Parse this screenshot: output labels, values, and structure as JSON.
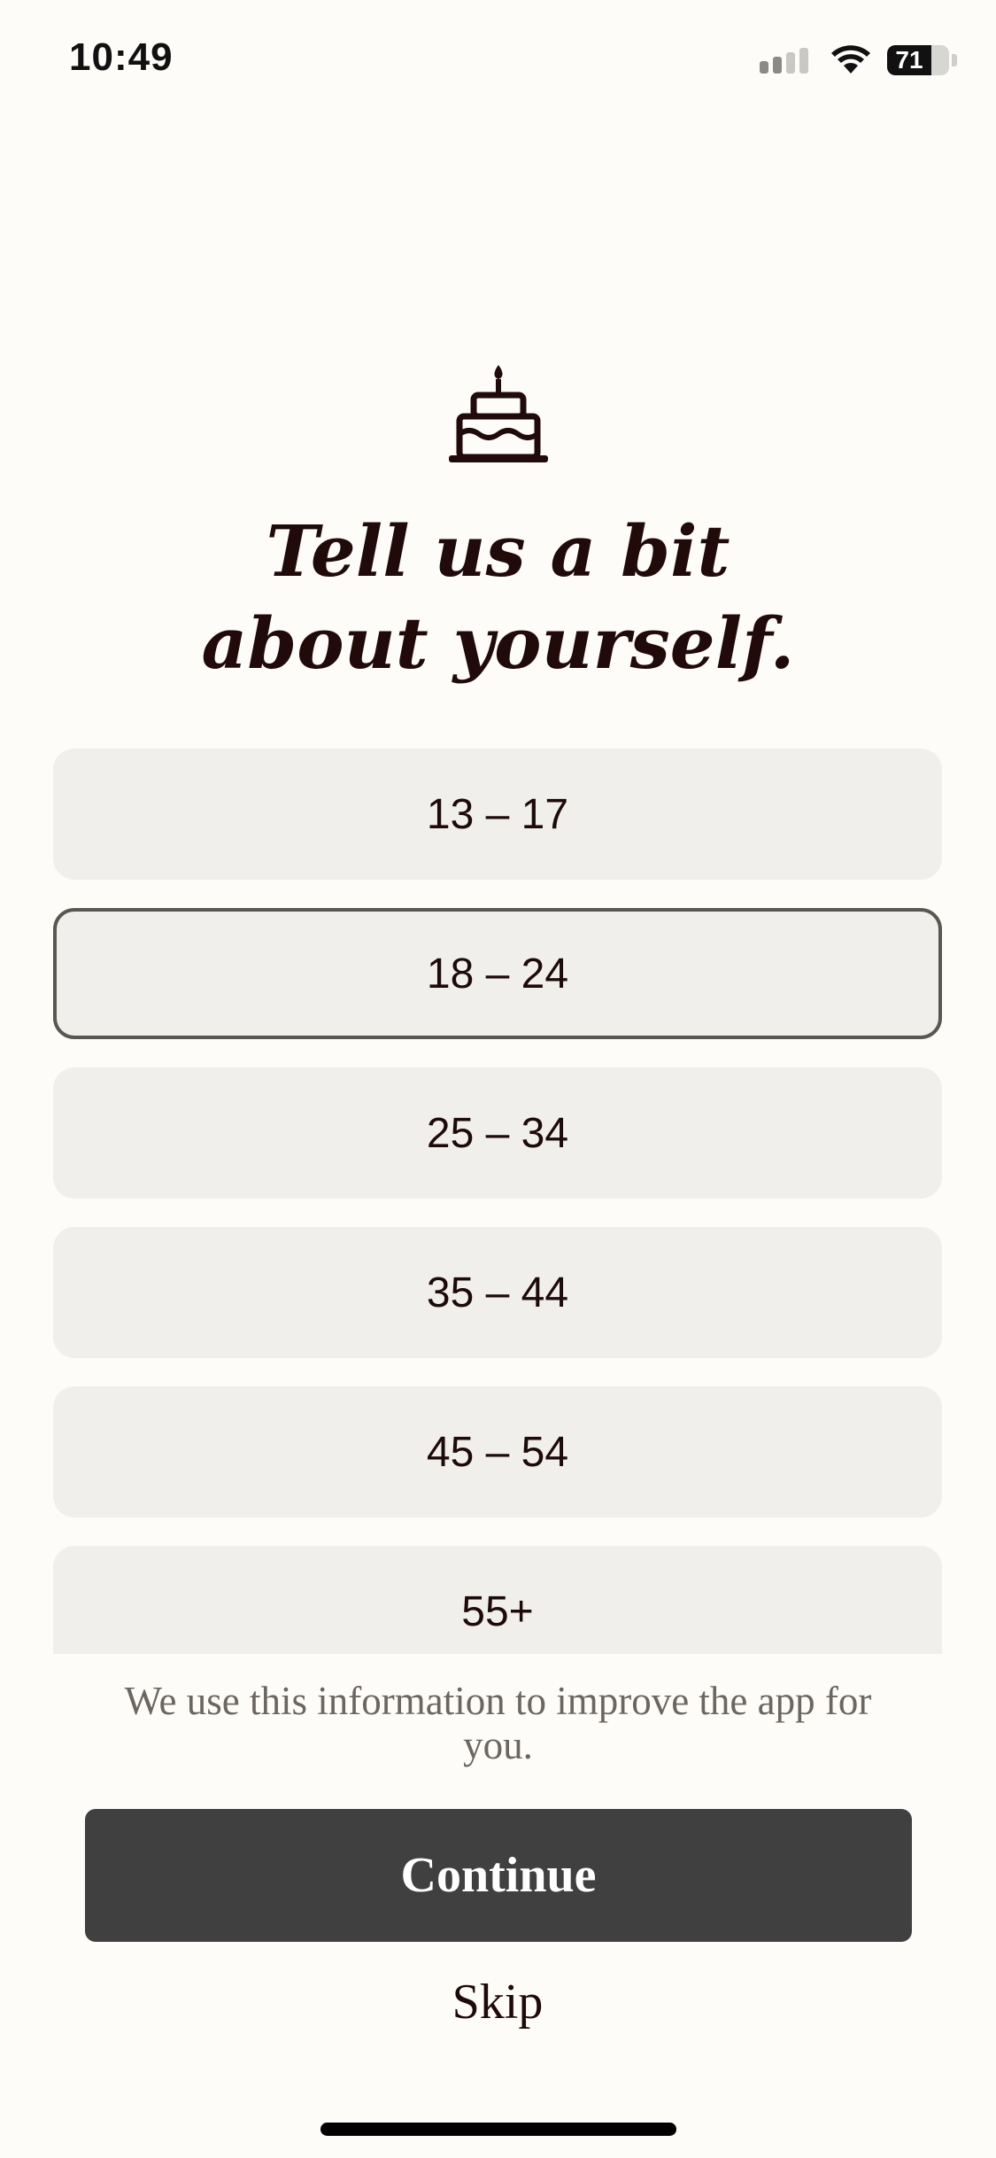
{
  "status_bar": {
    "time": "10:49",
    "battery_level": "71",
    "battery_fraction": 0.71,
    "icons": [
      "signal-icon",
      "wifi-icon",
      "battery-icon"
    ]
  },
  "header": {
    "icon": "birthday-cake-icon",
    "title_line1": "Tell us a bit",
    "title_line2": "about yourself."
  },
  "age_options": [
    {
      "label": "13 – 17",
      "selected": false
    },
    {
      "label": "18 – 24",
      "selected": true
    },
    {
      "label": "25 – 34",
      "selected": false
    },
    {
      "label": "35 – 44",
      "selected": false
    },
    {
      "label": "45 – 54",
      "selected": false
    },
    {
      "label": "55+",
      "selected": false
    }
  ],
  "footer": {
    "info_text": "We use this information to improve the app for you.",
    "continue_label": "Continue",
    "skip_label": "Skip"
  },
  "colors": {
    "background": "#fdfcf8",
    "option_background": "#f0efec",
    "selected_border": "#5a5753",
    "button_background": "#414040",
    "title_text": "#200a0a"
  }
}
